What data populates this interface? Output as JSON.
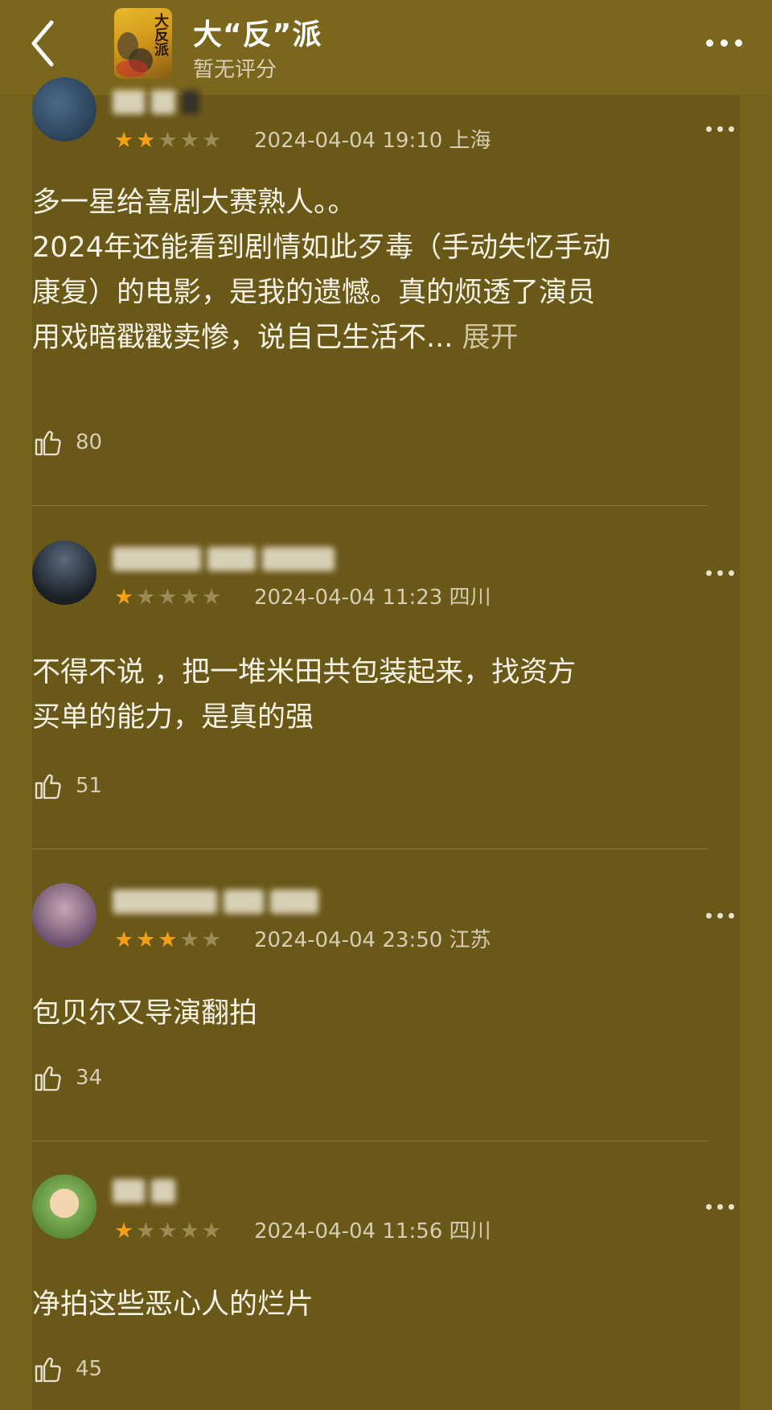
{
  "header": {
    "title": "大“反”派",
    "subtitle": "暂无评分",
    "poster_text": "大反派"
  },
  "reviews": [
    {
      "stars": "★★",
      "stars_off": "★★★",
      "rating": 2,
      "date": "2024-04-04 19:10 上海",
      "text_lines": [
        "多一星给喜剧大赛熟人。。",
        "2024年还能看到剧情如此歹毒（手动失忆手动",
        "康复）的电影，是我的遗憾。真的烦透了演员",
        "用戏暗戳戳卖惨，说自己生活不..."
      ],
      "expand": "展开",
      "likes": "80"
    },
    {
      "stars": "★",
      "stars_off": "★★★★",
      "rating": 1,
      "date": "2024-04-04 11:23 四川",
      "text_lines": [
        "不得不说 ，把一堆米田共包装起来，找资方",
        "买单的能力，是真的强"
      ],
      "likes": "51"
    },
    {
      "stars": "★★★",
      "stars_off": "★★",
      "rating": 3,
      "date": "2024-04-04 23:50 江苏",
      "text_lines": [
        "包贝尔又导演翻拍"
      ],
      "likes": "34"
    },
    {
      "stars": "★",
      "stars_off": "★★★★",
      "rating": 1,
      "date": "2024-04-04 11:56 四川",
      "text_lines": [
        "净拍这些恶心人的烂片"
      ],
      "likes": "45"
    }
  ],
  "colors": {
    "background": "#6b5a17",
    "header": "#7a661d",
    "star_on": "#f5a014",
    "star_off": "#9a8a55"
  },
  "icons": [
    "back-arrow-icon",
    "more-dots-icon",
    "thumbs-up-icon"
  ]
}
